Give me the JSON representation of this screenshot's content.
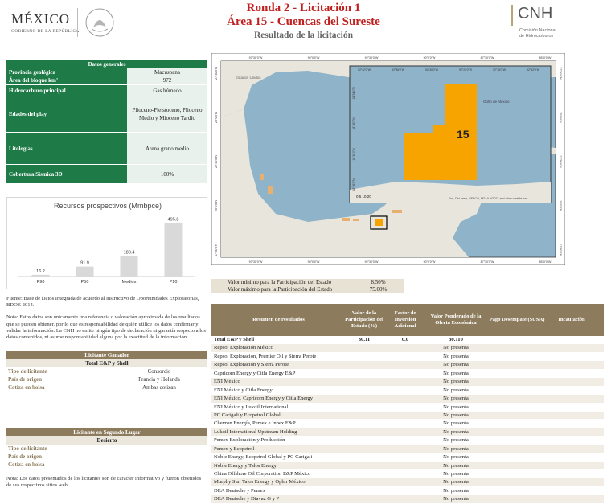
{
  "header": {
    "gov_name": "MÉXICO",
    "gov_sub": "GOBIERNO DE LA REPÚBLICA",
    "title1": "Ronda 2 - Licitación 1",
    "title2": "Área 15 - Cuencas del Sureste",
    "title3": "Resultado de la licitación",
    "cnh_logo": "CNH",
    "cnh_sub1": "Comisión Nacional",
    "cnh_sub2": "de Hidrocarburos",
    "colors": {
      "title": "#c0201f",
      "green": "#1e7b47",
      "tan": "#8c7b5c"
    }
  },
  "datos_generales": {
    "title": "Datos generales",
    "rows": [
      {
        "label": "Provincia geológica",
        "value": "Macuspana"
      },
      {
        "label": "Área del bloque km²",
        "value": "972"
      },
      {
        "label": "Hidrocarburo principal",
        "value": "Gas húmedo"
      },
      {
        "label": "Edades del play",
        "value": "Plioceno-Pleistoceno, Plioceno Medio y Mioceno Tardío"
      },
      {
        "label": "Litologías",
        "value": "Arena grano medio"
      },
      {
        "label": "Cobertura Sísmica 3D",
        "value": "100%"
      }
    ]
  },
  "chart_data": {
    "type": "bar",
    "title": "Recursos prospectivos (Mmbpce)",
    "categories": [
      "P90",
      "P50",
      "Medios",
      "P10"
    ],
    "values": [
      16.2,
      91.9,
      188.4,
      495.8
    ],
    "data_labels": [
      "16.2",
      "91.9",
      "188.4",
      "495.8"
    ],
    "ylim": [
      0,
      520
    ],
    "color": "#d9d9d9"
  },
  "fuente": "Fuente: Base de Datos Integrada de acuerdo al instructivo de Oportunidades Exploratorias, BDOE 2014.",
  "nota": "Nota: Estos datos son únicamente una referencia o valoración aproximada de los resultados que se pueden obtener, por lo que es responsabilidad de quién utilice los datos confirmar y validar la información. La CNH no emite ningún tipo de declaración ni garantía respecto a los datos contenidos, ni asume responsabilidad alguna por la exactitud de la información.",
  "ganador": {
    "head": "Licitante Ganador",
    "name": "Total E&P y Shell",
    "rows": [
      {
        "label": "Tipo de licitante",
        "value": "Consorcio"
      },
      {
        "label": "País de origen",
        "value": "Francia y Holanda"
      },
      {
        "label": "Cotiza en bolsa",
        "value": "Ambas cotizan"
      }
    ]
  },
  "segundo": {
    "head": "Licitante en Segundo Lugar",
    "name": "Desierto",
    "rows": [
      {
        "label": "Tipo de licitante",
        "value": ""
      },
      {
        "label": "País de origen",
        "value": ""
      },
      {
        "label": "Cotiza en bolsa",
        "value": ""
      }
    ]
  },
  "nota2": "Nota: Los datos presentados de los licitantes son de carácter informativo y fueron obtenidos de sus respectivos sitios web.",
  "map": {
    "block_label": "15",
    "gulf_label": "Golfo de México",
    "land_label": "Estados Unidos",
    "scale_label": "0 5 10 20",
    "attribution": "Esri, DeLorme, GEBCO, NOAA NGDC, and other contributors",
    "top_ticks": [
      "97°30'0\"W",
      "95°0'0\"W",
      "92°30'0\"W",
      "90°0'0\"W",
      "87°30'0\"W",
      "85°0'0\"W"
    ],
    "bottom_ticks": [
      "97°30'0\"W",
      "95°0'0\"W",
      "92°30'0\"W",
      "90°0'0\"W",
      "87°30'0\"W",
      "85°0'0\"W"
    ],
    "left_ticks": [
      "27°30'0\"N",
      "25°0'0\"N",
      "22°30'0\"N",
      "20°0'0\"N",
      "17°30'0\"N"
    ],
    "right_ticks": [
      "27°30'0\"N",
      "25°0'0\"N",
      "22°30'0\"N",
      "20°0'0\"N",
      "17°30'0\"N"
    ],
    "inset_top_ticks": [
      "92°42'0\"W",
      "92°36'0\"W",
      "92°30'0\"W",
      "92°24'0\"W",
      "92°18'0\"W",
      "92°12'0\"W"
    ],
    "inset_left_ticks": [
      "18°54'0\"N",
      "18°48'0\"N",
      "18°42'0\"N",
      "18°36'0\"N"
    ],
    "colors": {
      "sea": "#8fb3c9",
      "land": "#e8e6dc",
      "block": "#f7a400"
    }
  },
  "participacion": {
    "rows": [
      {
        "label": "Valor mínimo para la Participación del Estado",
        "value": "8.50%"
      },
      {
        "label": "Valor máximo para la Participación del Estado",
        "value": "75.00%"
      }
    ]
  },
  "resultados": {
    "headers": [
      "Resumen de resultados",
      "Valor de la Participación del Estado (%)",
      "Factor de Inversión Adicional",
      "Valor Ponderado de la Oferta Económica",
      "Pago Desempate ($USA)",
      "Incautación"
    ],
    "rows": [
      {
        "name": "Total E&P y Shell",
        "v1": "30.11",
        "v2": "0.0",
        "v3": "30.110",
        "bold": true
      },
      {
        "name": "Repsol Exploración México",
        "v3": "No presenta"
      },
      {
        "name": "Repsol Exploración, Premier Oil y Sierra Perote",
        "v3": "No presenta"
      },
      {
        "name": "Repsol Exploración y Sierra Perote",
        "v3": "No presenta"
      },
      {
        "name": "Capricorn Energy y Citla Energy E&P",
        "v3": "No presenta"
      },
      {
        "name": "ENI México",
        "v3": "No presenta"
      },
      {
        "name": "ENI México y Citla Energy",
        "v3": "No presenta"
      },
      {
        "name": "ENI México, Capricorn Energy y Citla Energy",
        "v3": "No presenta"
      },
      {
        "name": "ENI México y Lukoil International",
        "v3": "No presenta"
      },
      {
        "name": "PC Carigali y Ecopetrol Global",
        "v3": "No presenta"
      },
      {
        "name": "Chevron Energía, Pemex e Inpex E&P",
        "v3": "No presenta"
      },
      {
        "name": "Lukoil International Upstream Holding",
        "v3": "No presenta"
      },
      {
        "name": "Pemex Exploración y Producción",
        "v3": "No presenta"
      },
      {
        "name": "Pemex y Ecopetrol",
        "v3": "No presenta"
      },
      {
        "name": "Noble Energy, Ecopetrol Global y PC Carigali",
        "v3": "No presenta"
      },
      {
        "name": "Noble Energy y Talos Energy",
        "v3": "No presenta"
      },
      {
        "name": "China Offshore Oil Corporation E&P México",
        "v3": "No presenta"
      },
      {
        "name": "Murphy Sur, Talos Energy y Ophir México",
        "v3": "No presenta"
      },
      {
        "name": "DEA Deutsche y Pemex",
        "v3": "No presenta"
      },
      {
        "name": "DEA Deutsche y Diavaz G y P",
        "v3": "No presenta"
      }
    ]
  }
}
